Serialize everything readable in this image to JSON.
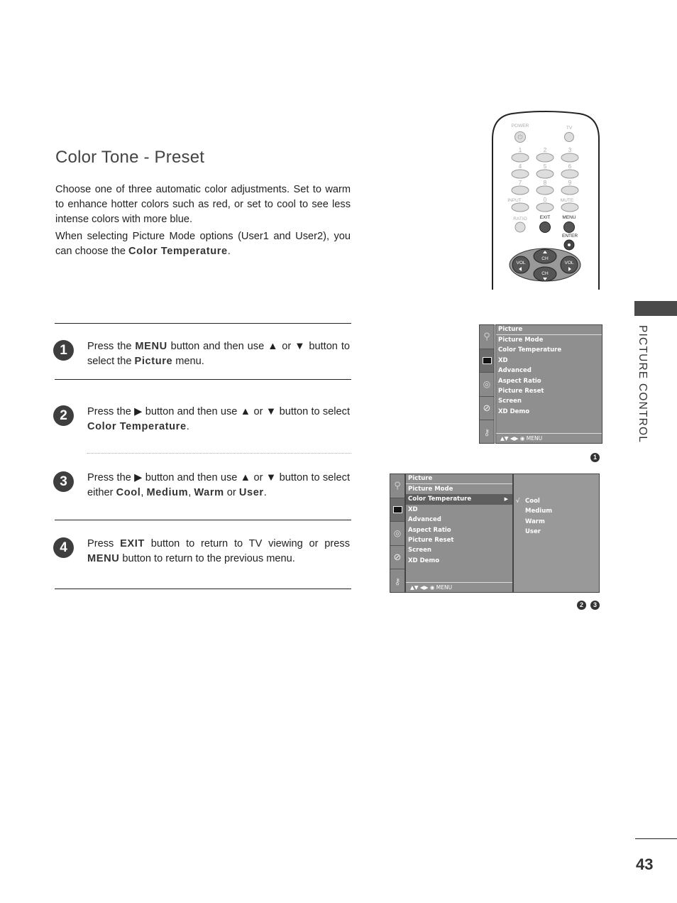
{
  "title": "Color Tone - Preset",
  "intro": {
    "para1": "Choose one of three automatic color adjustments. Set to warm to enhance hotter colors such as red, or set to cool to see less intense colors with more blue.",
    "para2_prefix": "When selecting Picture Mode options (User1 and User2), you can choose the ",
    "para2_keyword": "Color Temperature",
    "para2_suffix": "."
  },
  "steps": [
    {
      "number": "1",
      "parts": [
        "Press the ",
        "MENU",
        " button and then use ▲ or ▼ button to select the ",
        "Picture",
        " menu."
      ]
    },
    {
      "number": "2",
      "parts": [
        "Press the ▶ button and then use ▲ or ▼ button to select ",
        "Color Temperature",
        "."
      ]
    },
    {
      "number": "3",
      "parts": [
        "Press the ▶ button and then use ▲ or ▼ button to select either ",
        "Cool",
        ", ",
        "Medium",
        ", ",
        "Warm",
        " or ",
        "User",
        "."
      ]
    },
    {
      "number": "4",
      "parts": [
        "Press ",
        "EXIT",
        " button to return to TV viewing or press ",
        "MENU",
        " button to return to the previous menu."
      ]
    }
  ],
  "remote": {
    "power": "POWER",
    "tv": "TV",
    "digits": [
      "1",
      "2",
      "3",
      "4",
      "5",
      "6",
      "7",
      "8",
      "9"
    ],
    "input": "INPUT",
    "zero": "0",
    "mute": "MUTE",
    "ratio": "RATIO",
    "exit": "EXIT",
    "menu": "MENU",
    "enter": "ENTER",
    "ch": "CH",
    "vol": "VOL"
  },
  "side_tab": {
    "label": "PICTURE CONTROL"
  },
  "page_number": "43",
  "osd_menu_1": {
    "header": "Picture",
    "items": [
      "Picture Mode",
      "Color Temperature",
      "XD",
      "Advanced",
      "Aspect Ratio",
      "Picture Reset",
      "Screen",
      "XD Demo"
    ],
    "footer": "▲▼  ◀▶  ◉  MENU",
    "ref": "1"
  },
  "osd_menu_2": {
    "header": "Picture",
    "items": [
      "Picture Mode",
      "Color Temperature",
      "XD",
      "Advanced",
      "Aspect Ratio",
      "Picture Reset",
      "Screen",
      "XD Demo"
    ],
    "selected_index": 1,
    "footer": "▲▼  ◀▶  ◉  MENU",
    "submenu": [
      "Cool",
      "Medium",
      "Warm",
      "User"
    ],
    "checked": "Cool",
    "check_glyph": "√",
    "arrow": "▶",
    "refs": [
      "2",
      "3"
    ]
  }
}
